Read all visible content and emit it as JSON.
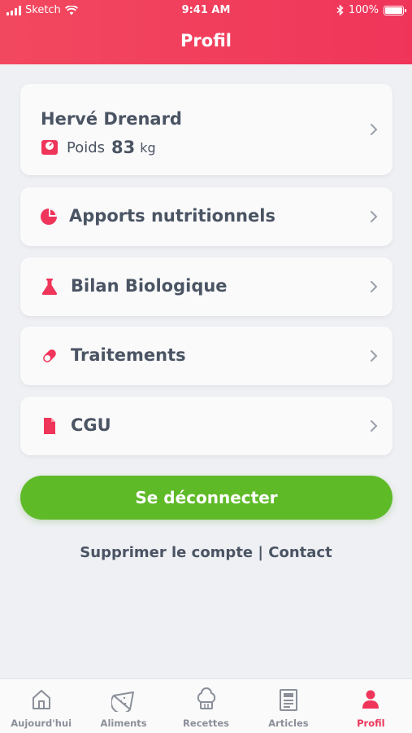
{
  "status_bar": {
    "carrier": "Sketch",
    "time": "9:41 AM",
    "battery": "100%"
  },
  "header": {
    "title": "Profil"
  },
  "profile": {
    "name": "Hervé Drenard",
    "weight_label": "Poids",
    "weight_value": "83",
    "weight_unit": "kg"
  },
  "menu": [
    {
      "label": "Apports nutritionnels",
      "icon": "pie-chart-icon"
    },
    {
      "label": "Bilan Biologique",
      "icon": "flask-icon"
    },
    {
      "label": "Traitements",
      "icon": "pill-icon"
    },
    {
      "label": "CGU",
      "icon": "document-icon"
    }
  ],
  "actions": {
    "logout": "Se déconnecter",
    "delete_account": "Supprimer le compte",
    "separator": "|",
    "contact": "Contact"
  },
  "tabs": [
    {
      "label": "Aujourd'hui",
      "icon": "home-icon"
    },
    {
      "label": "Aliments",
      "icon": "watermelon-icon"
    },
    {
      "label": "Recettes",
      "icon": "chef-hat-icon"
    },
    {
      "label": "Articles",
      "icon": "article-icon"
    },
    {
      "label": "Profil",
      "icon": "user-icon"
    }
  ],
  "colors": {
    "accent": "#f0355a",
    "logout": "#5fba28",
    "text": "#4a5463",
    "tab_inactive": "#8a8f99"
  }
}
